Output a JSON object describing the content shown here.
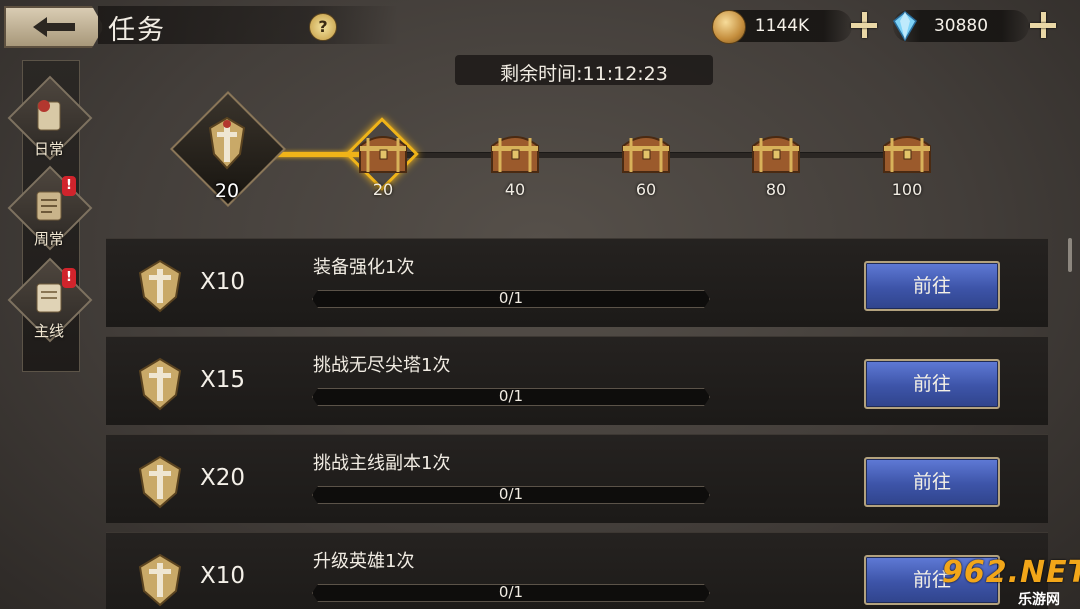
{
  "header": {
    "title": "任务",
    "help_label": "?",
    "gold_value": "1144K",
    "gem_value": "30880",
    "icons": {
      "back": "back-arrow-icon",
      "gold": "gold-coin-icon",
      "gem": "blue-crystal-icon",
      "add": "plus-icon",
      "help": "question-icon"
    }
  },
  "timer": {
    "text": "剩余时间:11:12:23"
  },
  "tabs": [
    {
      "label": "日常",
      "alert": false
    },
    {
      "label": "周常",
      "alert": true
    },
    {
      "label": "主线",
      "alert": true
    }
  ],
  "alert_mark": "!",
  "progress": {
    "current_points": "20",
    "milestones": [
      {
        "label": "20",
        "reached": true
      },
      {
        "label": "40",
        "reached": false
      },
      {
        "label": "60",
        "reached": false
      },
      {
        "label": "80",
        "reached": false
      },
      {
        "label": "100",
        "reached": false
      }
    ],
    "colors": {
      "reached": "#f0b419",
      "pending": "#2a2623"
    }
  },
  "tasks": [
    {
      "reward": "X10",
      "name": "装备强化1次",
      "progress": "0/1",
      "button": "前往"
    },
    {
      "reward": "X15",
      "name": "挑战无尽尖塔1次",
      "progress": "0/1",
      "button": "前往"
    },
    {
      "reward": "X20",
      "name": "挑战主线副本1次",
      "progress": "0/1",
      "button": "前往"
    },
    {
      "reward": "X10",
      "name": "升级英雄1次",
      "progress": "0/1",
      "button": "前往"
    }
  ],
  "watermark": {
    "logo": "962.NET",
    "sub": "乐游网"
  }
}
